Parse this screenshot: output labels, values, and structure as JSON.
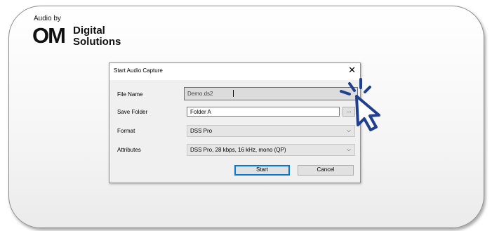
{
  "brand": {
    "prefix": "Audio by",
    "om": "OM",
    "line1": "Digital",
    "line2": "Solutions"
  },
  "dialog": {
    "title": "Start Audio Capture",
    "close_glyph": "✕",
    "file_name": {
      "label": "File Name",
      "value": "Demo.ds2"
    },
    "save_folder": {
      "label": "Save Folder",
      "value": "Folder A",
      "browse_label": "..."
    },
    "format": {
      "label": "Format",
      "value": "DSS Pro"
    },
    "attributes": {
      "label": "Attributes",
      "value": "DSS Pro, 28 kbps, 16 kHz, mono (QP)"
    },
    "start_label": "Start",
    "cancel_label": "Cancel",
    "chevron": "⌵"
  },
  "annotation": {
    "icon": "click-pointer-icon",
    "color": "#1f3f8f"
  }
}
